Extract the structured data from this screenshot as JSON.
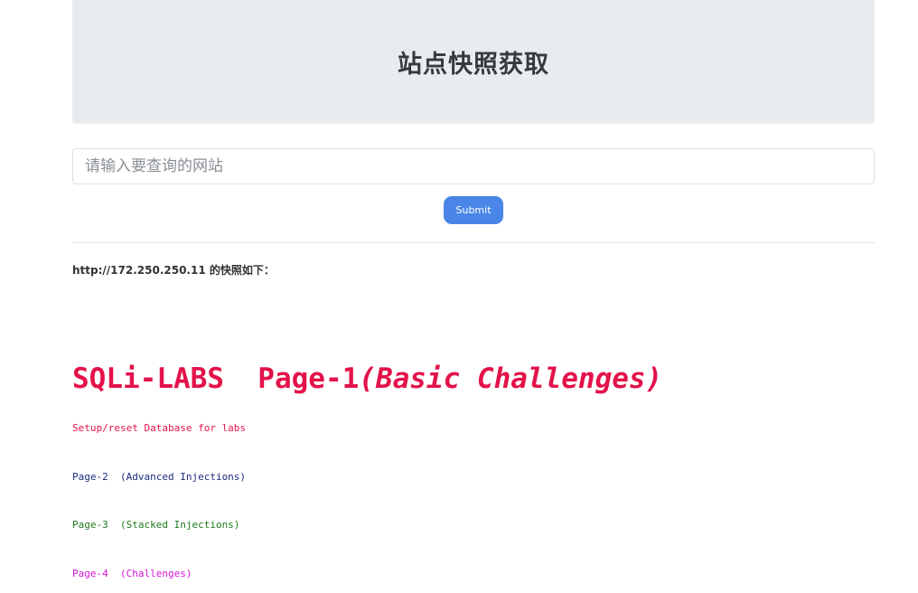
{
  "header": {
    "title": "站点快照获取"
  },
  "form": {
    "url_placeholder": "请输入要查询的网站",
    "url_value": "",
    "submit_label": "Submit"
  },
  "result": {
    "label": "http://172.250.250.11 的快照如下："
  },
  "snapshot": {
    "title_main": "SQLi-LABS  Page-1",
    "title_italic": "(Basic Challenges)",
    "links": [
      {
        "text": "Setup/reset Database for labs",
        "color": "#e3124a"
      },
      {
        "text": "Page-2  (Advanced Injections)",
        "color": "#1a2b7a"
      },
      {
        "text": "Page-3  (Stacked Injections)",
        "color": "#1e7a1e"
      },
      {
        "text": "Page-4  (Challenges)",
        "color": "#d415d4"
      }
    ]
  },
  "colors": {
    "accent": "#4a86e8",
    "title_red": "#e3124a"
  }
}
